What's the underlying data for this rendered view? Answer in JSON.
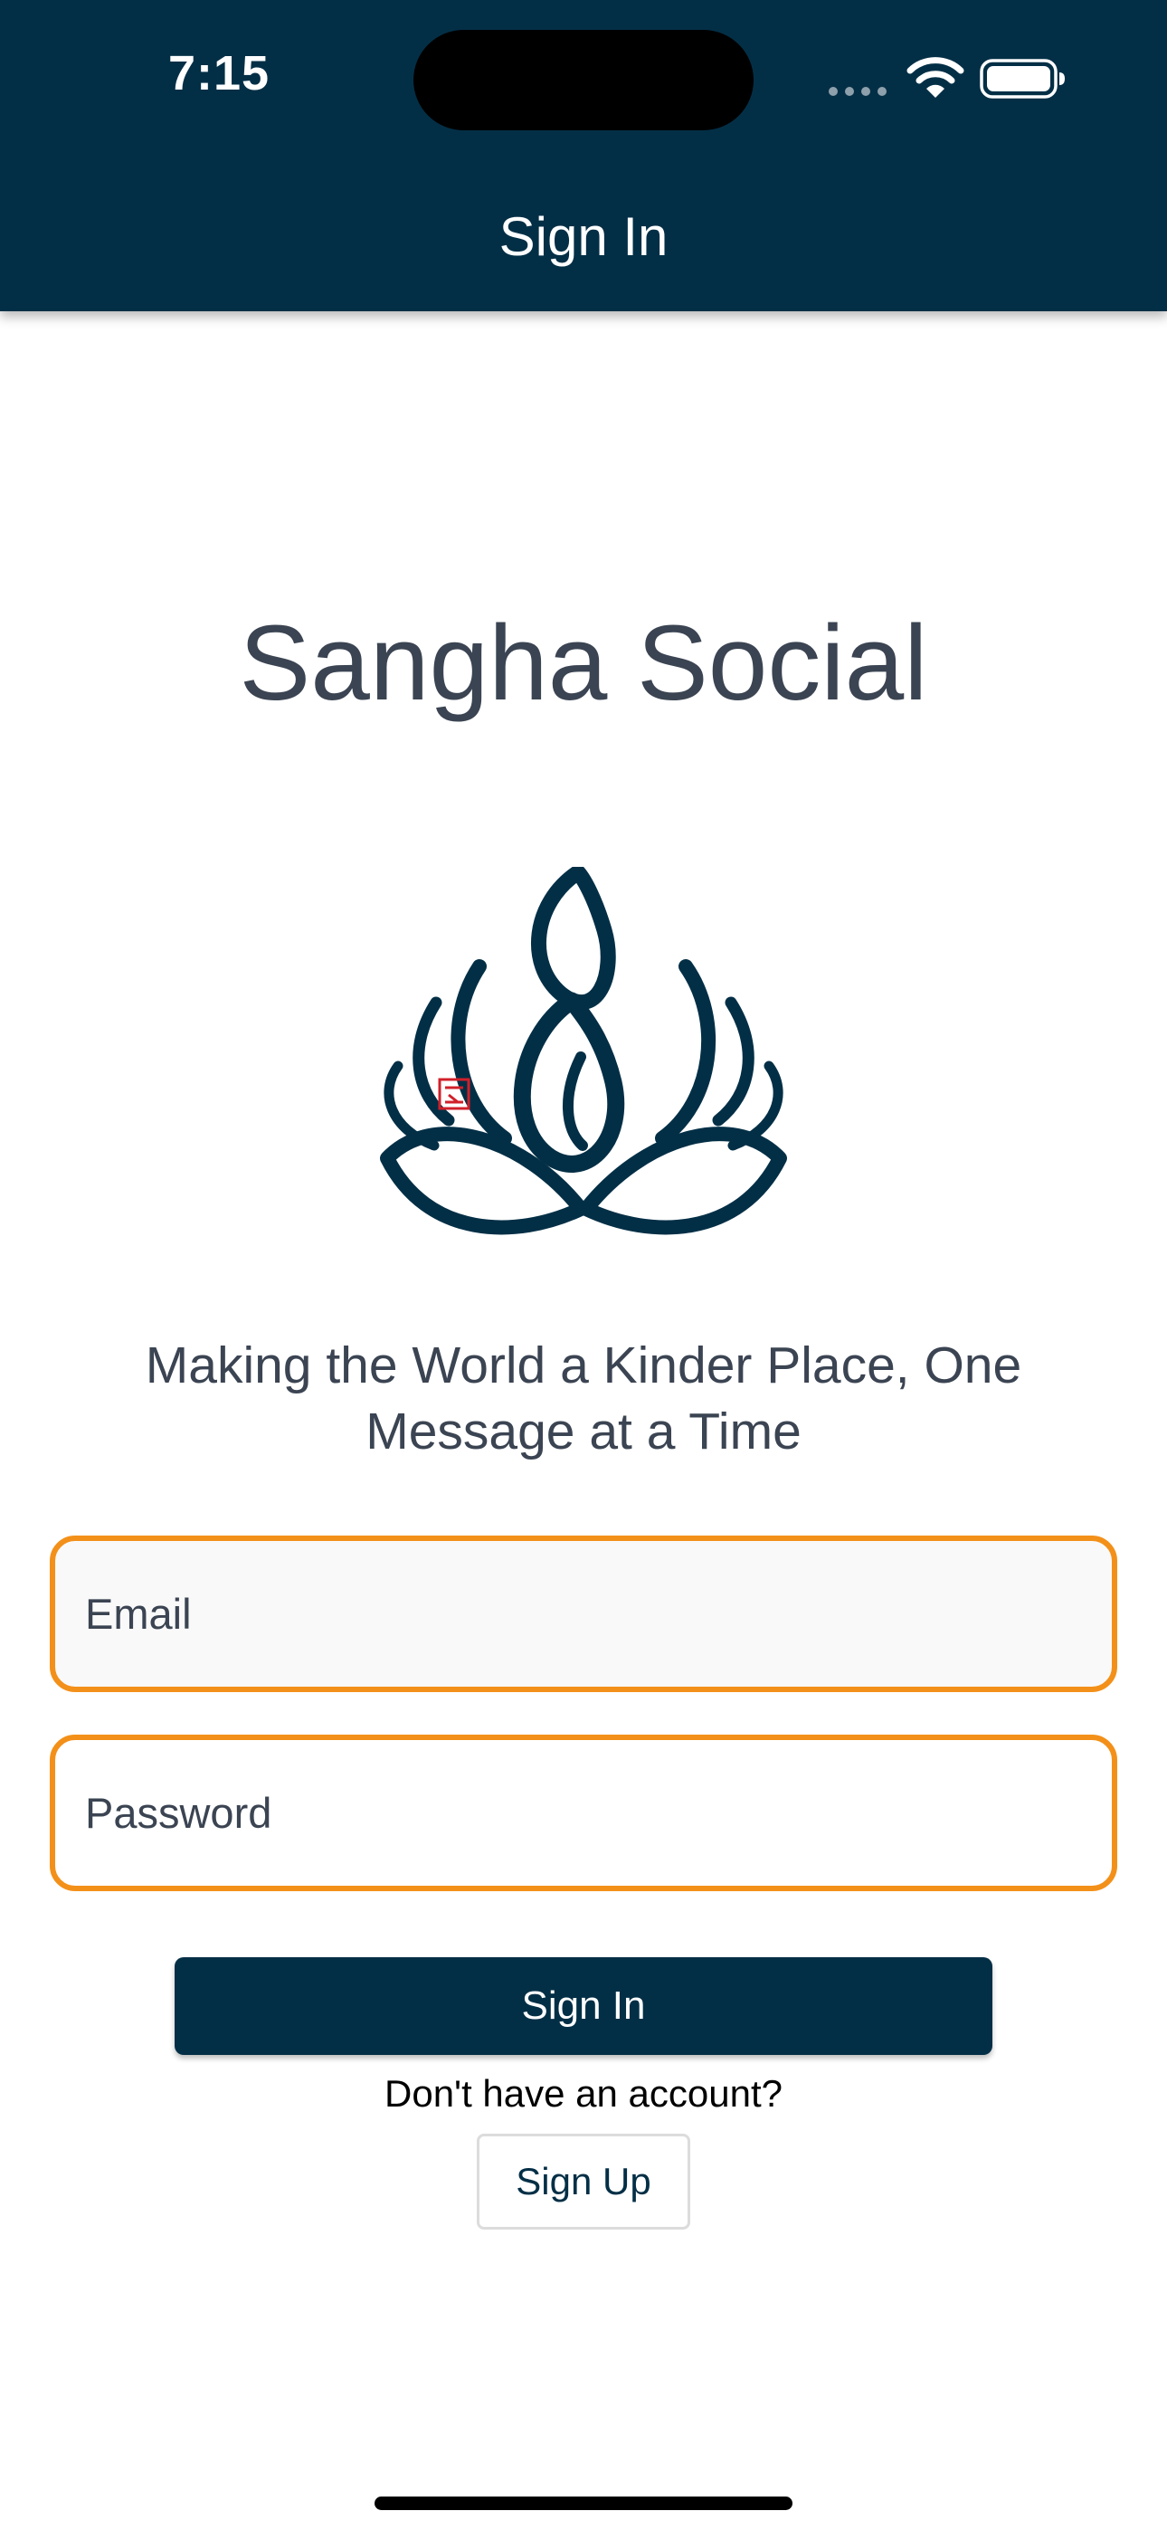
{
  "status_bar": {
    "time": "7:15"
  },
  "header": {
    "title": "Sign In"
  },
  "main": {
    "app_title": "Sangha Social",
    "logo_icon": "lotus-meditation-icon",
    "tagline": "Making the World a Kinder Place, One Message at a Time"
  },
  "form": {
    "email_placeholder": "Email",
    "email_value": "",
    "password_placeholder": "Password",
    "password_value": "",
    "signin_label": "Sign In",
    "account_prompt": "Don't have an account?",
    "signup_label": "Sign Up"
  },
  "colors": {
    "brand_navy": "#032f46",
    "field_border_orange": "#f39019",
    "text_gray": "#3b4452",
    "seal_red": "#d0202a"
  }
}
